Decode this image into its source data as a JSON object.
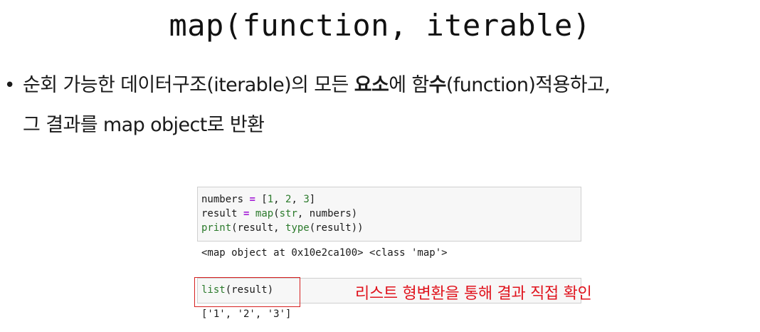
{
  "title": "map(function, iterable)",
  "bullet": {
    "dot": "•",
    "line1_a": "순회 가능한 데이터구조(iterable)의 모든 ",
    "line1_b": "요소",
    "line1_c": "에 함",
    "line1_d": "수",
    "line1_e": "(function)적용하고,",
    "line2": "그 결과를 map object로 반환"
  },
  "code_cell_1": {
    "line1": {
      "a": "numbers ",
      "op": "=",
      "b": " [",
      "n1": "1",
      "c": ", ",
      "n2": "2",
      "d": ", ",
      "n3": "3",
      "e": "]"
    },
    "line2": {
      "a": "result ",
      "op": "=",
      "b": " ",
      "fn_map": "map",
      "c": "(",
      "fn_str": "str",
      "d": ", numbers)"
    },
    "line3": {
      "fn_print": "print",
      "a": "(result, ",
      "fn_type": "type",
      "b": "(result))"
    }
  },
  "output_1": "<map object at 0x10e2ca100> <class 'map'>",
  "code_cell_2": {
    "fn_list": "list",
    "rest": "(result)"
  },
  "output_2": "['1', '2', '3']",
  "annotation": "리스트 형변환을 통해 결과 직접 확인",
  "colors": {
    "builtin": "#2b7a2b",
    "operator": "#a41ed6",
    "annotation": "#e0141e",
    "highlight_border": "#d62020",
    "cell_background": "#f7f7f7"
  }
}
